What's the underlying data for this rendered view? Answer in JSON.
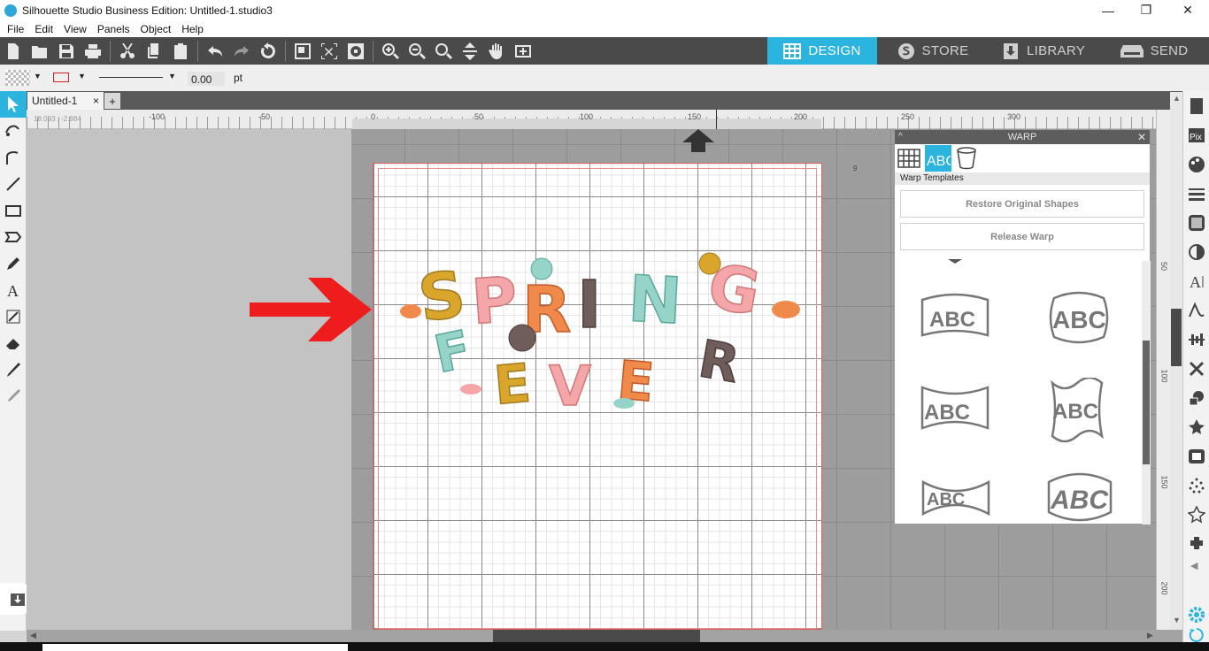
{
  "window": {
    "title": "Silhouette Studio Business Edition: Untitled-1.studio3",
    "min": "—",
    "max": "❐",
    "close": "✕"
  },
  "menu": [
    "File",
    "Edit",
    "View",
    "Panels",
    "Object",
    "Help"
  ],
  "nav_tabs": {
    "design": "DESIGN",
    "store": "STORE",
    "library": "LIBRARY",
    "send": "SEND"
  },
  "propbar": {
    "line_width": "0.00",
    "unit": "pt"
  },
  "doc_tab": {
    "label": "Untitled-1",
    "close": "×",
    "add": "+"
  },
  "ruler": {
    "coords": "18.093 , -2.984",
    "h_ticks": [
      "-100",
      "-50",
      "0",
      "50",
      "100",
      "150",
      "200",
      "250",
      "300"
    ],
    "v_ticks": [
      "50",
      "100",
      "150",
      "200"
    ]
  },
  "design": {
    "line1": [
      "S",
      "P",
      "R",
      "I",
      "N",
      "G"
    ],
    "line2": [
      "F",
      "E",
      "V",
      "E",
      "R"
    ]
  },
  "warp_panel": {
    "title": "WARP",
    "section": "Warp Templates",
    "restore": "Restore Original Shapes",
    "release": "Release Warp",
    "template_text": "ABC"
  },
  "colors": {
    "accent": "#2bb5de",
    "arrow": "#ee1c1c",
    "mustard": "#d9a62b",
    "pink": "#f4a6a8",
    "teal": "#96d4c9",
    "orange": "#ef8a4a",
    "brown": "#6e5d5b"
  }
}
